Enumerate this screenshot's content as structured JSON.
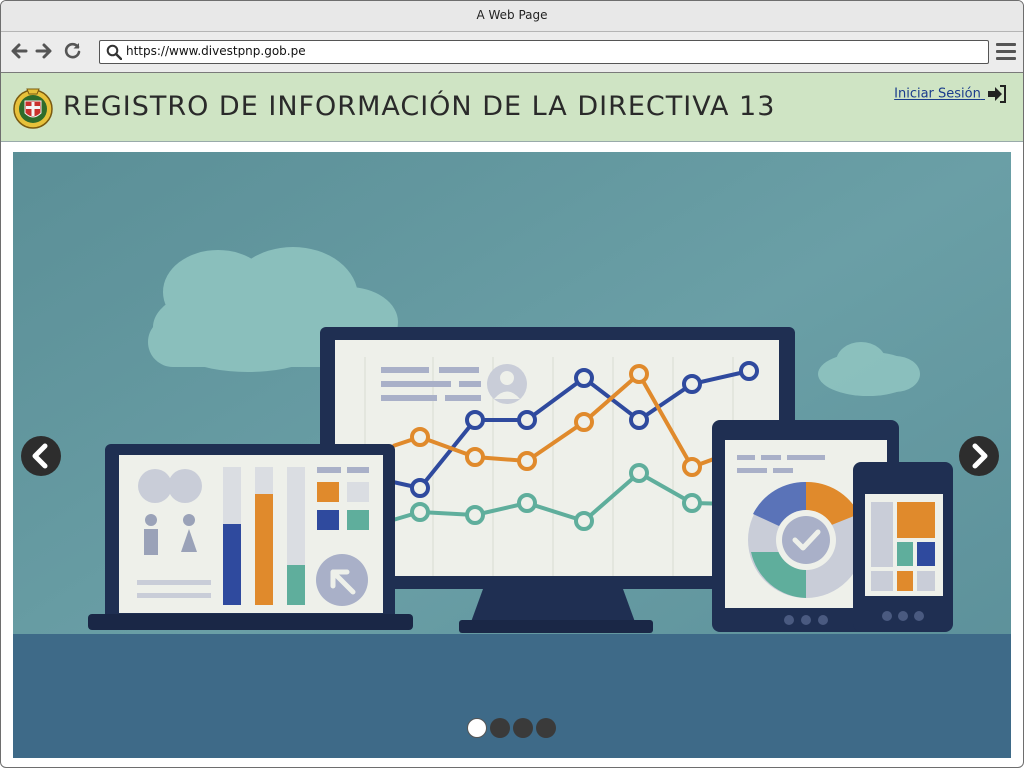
{
  "window": {
    "title": "A Web Page"
  },
  "browser": {
    "url": "https://www.divestpnp.gob.pe",
    "back_icon": "arrow-left-icon",
    "forward_icon": "arrow-right-icon",
    "reload_icon": "reload-icon",
    "menu_icon": "hamburger-menu-icon"
  },
  "header": {
    "title": "REGISTRO DE INFORMACIÓN DE LA DIRECTIVA 13",
    "login_label": "Iniciar Sesión",
    "login_icon": "sign-in-icon",
    "logo": "police-emblem-logo",
    "background": "#cfe4c4"
  },
  "carousel": {
    "image": "analytics-devices-illustration",
    "prev_icon": "chevron-left-icon",
    "next_icon": "chevron-right-icon",
    "slides_total": 4,
    "active_slide": 1
  }
}
